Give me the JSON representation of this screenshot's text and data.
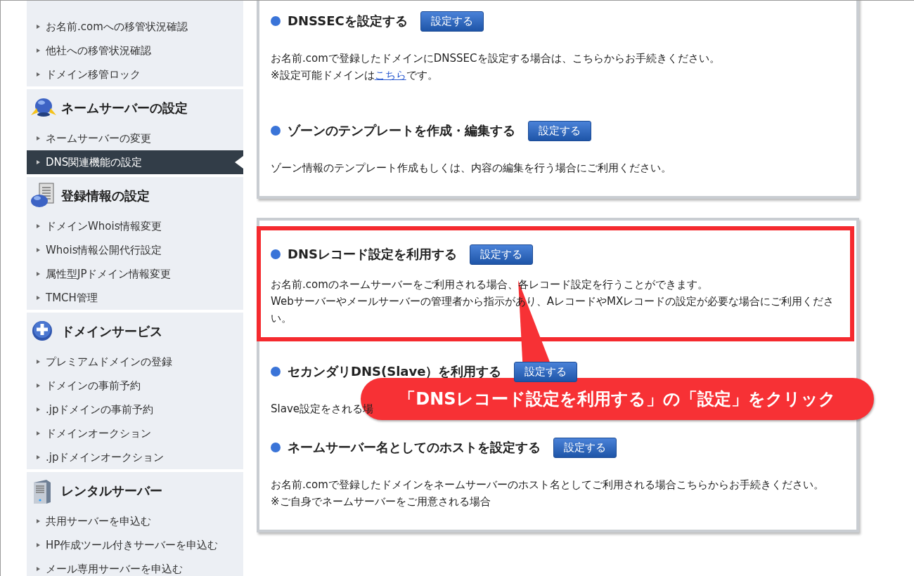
{
  "sidebar": {
    "sections": [
      {
        "items": [
          {
            "label": "お名前.comへの移管状況確認",
            "selected": false
          },
          {
            "label": "他社への移管状況確認",
            "selected": false
          },
          {
            "label": "ドメイン移管ロック",
            "selected": false
          }
        ]
      },
      {
        "heading": "ネームサーバーの設定",
        "items": [
          {
            "label": "ネームサーバーの変更",
            "selected": false
          },
          {
            "label": "DNS関連機能の設定",
            "selected": true
          }
        ]
      },
      {
        "heading": "登録情報の設定",
        "items": [
          {
            "label": "ドメインWhois情報変更",
            "selected": false
          },
          {
            "label": "Whois情報公開代行設定",
            "selected": false
          },
          {
            "label": "属性型JPドメイン情報変更",
            "selected": false
          },
          {
            "label": "TMCH管理",
            "selected": false
          }
        ]
      },
      {
        "heading": "ドメインサービス",
        "items": [
          {
            "label": "プレミアムドメインの登録",
            "selected": false
          },
          {
            "label": "ドメインの事前予約",
            "selected": false
          },
          {
            "label": ".jpドメインの事前予約",
            "selected": false
          },
          {
            "label": "ドメインオークション",
            "selected": false
          },
          {
            "label": ".jpドメインオークション",
            "selected": false
          }
        ]
      },
      {
        "heading": "レンタルサーバー",
        "items": [
          {
            "label": "共用サーバーを申込む",
            "selected": false
          },
          {
            "label": "HP作成ツール付きサーバーを申込む",
            "selected": false
          },
          {
            "label": "メール専用サーバーを申込む",
            "selected": false
          }
        ]
      }
    ]
  },
  "cards": [
    {
      "entries": [
        {
          "title": "DNSSECを設定する",
          "button": "設定する",
          "highlighted": false,
          "description": [
            {
              "text": "お名前.comで登録したドメインにDNSSECを設定する場合は、こちらからお手続きください。"
            },
            {
              "text": "※設定可能ドメインは",
              "link": "こちら",
              "after": "です。"
            }
          ]
        },
        {
          "title": "ゾーンのテンプレートを作成・編集する",
          "button": "設定する",
          "highlighted": false,
          "description": [
            {
              "text": "ゾーン情報のテンプレート作成もしくは、内容の編集を行う場合にご利用ください。"
            }
          ]
        }
      ]
    },
    {
      "entries": [
        {
          "title": "DNSレコード設定を利用する",
          "button": "設定する",
          "highlighted": true,
          "description": [
            {
              "text": "お名前.comのネームサーバーをご利用される場合、各レコード設定を行うことができます。"
            },
            {
              "text": "Webサーバーやメールサーバーの管理者から指示があり、AレコードやMXレコードの設定が必要な場合にご利用ください。"
            }
          ]
        },
        {
          "title": "セカンダリDNS(Slave）を利用する",
          "button": "設定する",
          "highlighted": false,
          "description": [
            {
              "text": "Slave設定をされる場"
            }
          ]
        },
        {
          "title": "ネームサーバー名としてのホストを設定する",
          "button": "設定する",
          "highlighted": false,
          "description": [
            {
              "text": "お名前.comで登録したドメインをネームサーバーのホスト名としてご利用される場合こちらからお手続きください。"
            },
            {
              "text": "※ご自身でネームサーバーをご用意される場合"
            }
          ]
        }
      ]
    }
  ],
  "callout": {
    "text": "「DNSレコード設定を利用する」の「設定」をクリック"
  }
}
